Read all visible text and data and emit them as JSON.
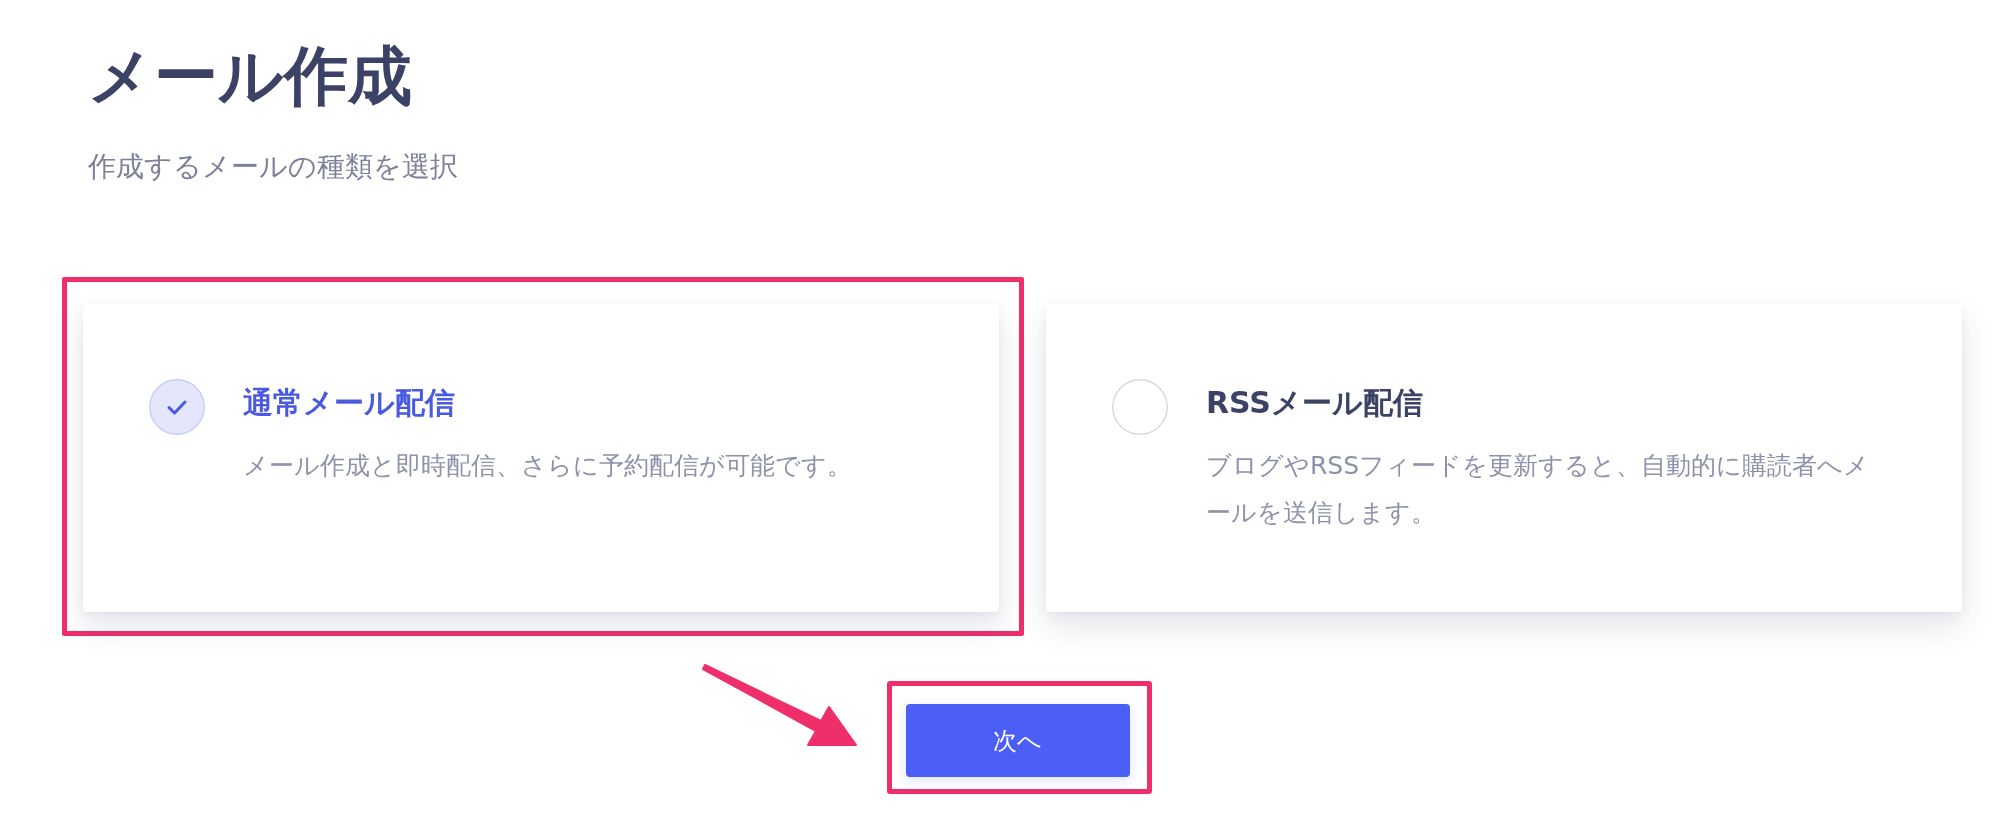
{
  "page": {
    "title": "メール作成",
    "subtitle": "作成するメールの種類を選択"
  },
  "options": [
    {
      "title": "通常メール配信",
      "description": "メール作成と即時配信、さらに予約配信が可能です。",
      "selected": true,
      "highlighted": true
    },
    {
      "title": "RSSメール配信",
      "description": "ブログやRSSフィードを更新すると、自動的に購読者へメールを送信します。",
      "selected": false,
      "highlighted": false
    }
  ],
  "next_button": {
    "label": "次へ",
    "highlighted": true
  },
  "annotation_arrow": true
}
